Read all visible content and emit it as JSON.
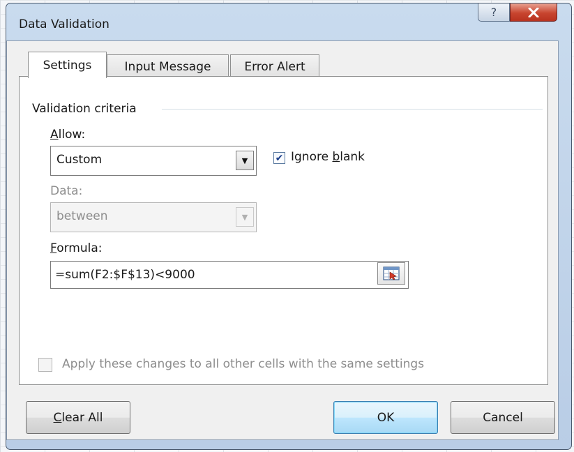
{
  "dialog": {
    "title": "Data Validation",
    "help_symbol": "?",
    "close_symbol": "x"
  },
  "tabs": [
    {
      "label": "Settings",
      "selected": true
    },
    {
      "label": "Input Message",
      "selected": false
    },
    {
      "label": "Error Alert",
      "selected": false
    }
  ],
  "settings": {
    "group_label": "Validation criteria",
    "allow": {
      "label_mnemonic": "A",
      "label_rest": "llow:",
      "value": "Custom"
    },
    "ignore_blank": {
      "label_pre": "Ignore ",
      "label_mnemonic": "b",
      "label_post": "lank",
      "checked": true,
      "check_glyph": "✔"
    },
    "data": {
      "label": "Data:",
      "value": "between",
      "enabled": false
    },
    "formula": {
      "label_mnemonic": "F",
      "label_rest": "ormula:",
      "value": "=sum(F2:$F$13)<9000"
    },
    "apply_all": {
      "label": "Apply these changes to all other cells with the same settings",
      "checked": false,
      "enabled": false
    }
  },
  "buttons": {
    "clear_all": {
      "mnemonic": "C",
      "rest": "lear All"
    },
    "ok": "OK",
    "cancel": "Cancel"
  },
  "colors": {
    "titlebar": "#c9dbee",
    "close_button": "#c8452f",
    "default_button": "#bee6fd"
  }
}
